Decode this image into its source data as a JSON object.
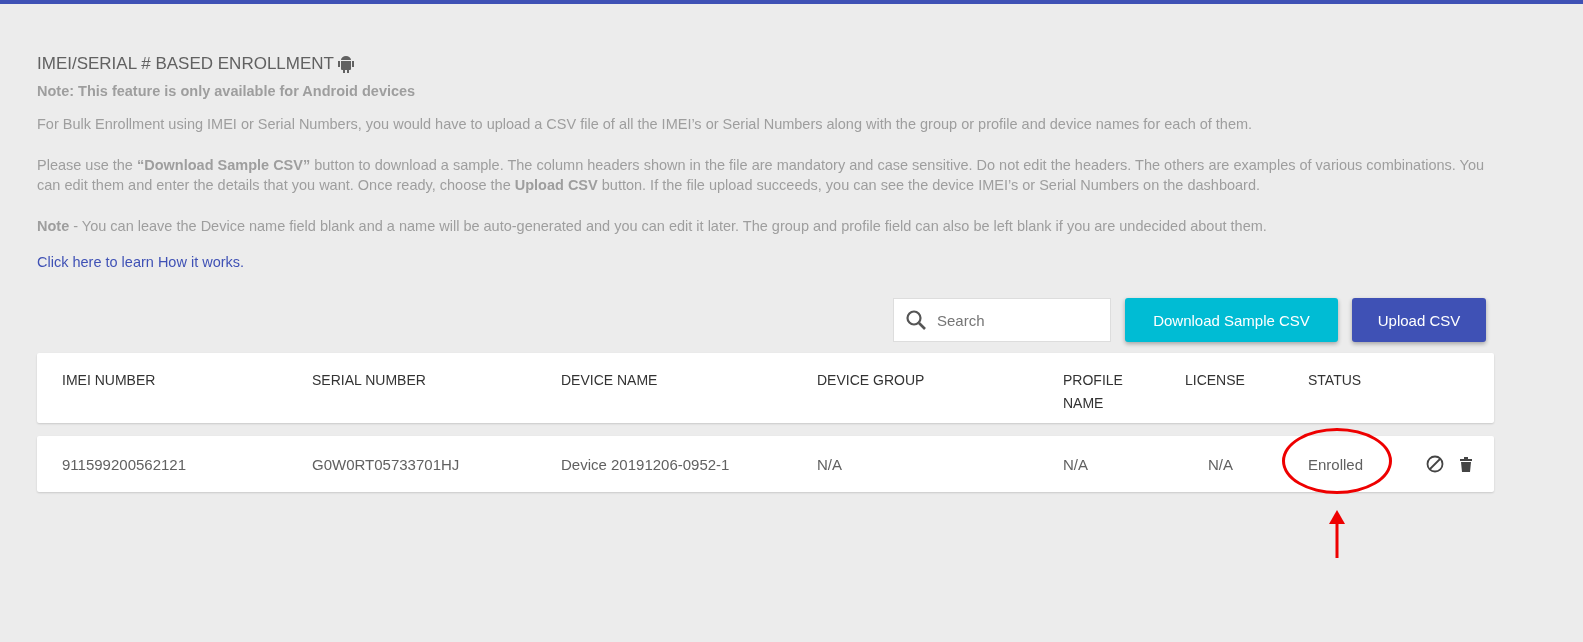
{
  "page": {
    "title": "IMEI/SERIAL # BASED ENROLLMENT",
    "note": "Note: This feature is only available for Android devices",
    "paragraphs": [
      "For Bulk Enrollment using IMEI or Serial Numbers, you would have to upload a CSV file of all the IMEI’s or Serial Numbers along with the group or profile and device names for each of them.",
      "Please use the **“Download Sample CSV”** button to download a sample. The column headers shown in the file are mandatory and case sensitive. Do not edit the headers. The others are examples of various combinations. You can edit them and enter the details that you want. Once ready, choose the **Upload CSV** button. If the file upload succeeds, you can see the device IMEI’s or Serial Numbers on the dashboard.",
      "**Note** - You can leave the Device name field blank and a name will be auto-generated and you can edit it later. The group and profile field can also be left blank if you are undecided about them."
    ],
    "link": "Click here to learn How it works."
  },
  "toolbar": {
    "search": {
      "placeholder": "Search"
    },
    "buttons": [
      {
        "label": "Download Sample CSV",
        "kind": "secondary"
      },
      {
        "label": "Upload CSV",
        "kind": "primary"
      }
    ]
  },
  "table": {
    "columns": [
      "IMEI NUMBER",
      "SERIAL NUMBER",
      "DEVICE NAME",
      "DEVICE GROUP",
      "PROFILE NAME",
      "LICENSE",
      "STATUS"
    ],
    "rows": [
      {
        "cells": [
          "911599200562121",
          "G0W0RT05733701HJ",
          "Device 20191206-0952-1",
          "N/A",
          "N/A",
          "N/A",
          "Enrolled"
        ],
        "highlighted": true
      }
    ]
  }
}
